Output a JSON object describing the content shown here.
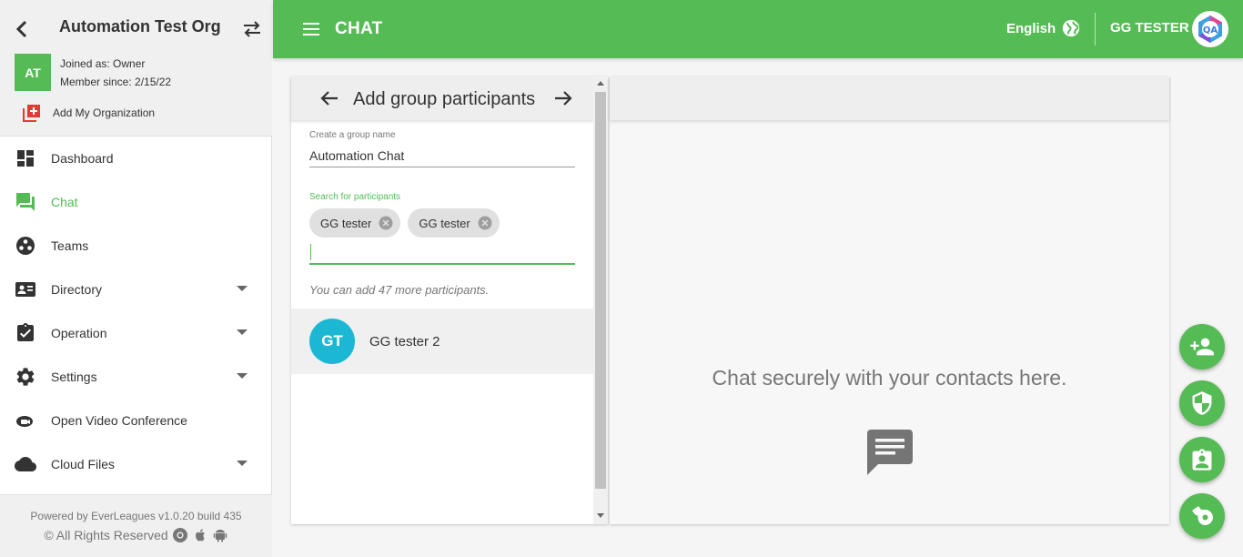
{
  "sidebar": {
    "org_name": "Automation Test Org",
    "org_initials": "AT",
    "joined_as": "Joined as: Owner",
    "member_since": "Member since: 2/15/22",
    "add_org": "Add My Organization",
    "nav": [
      {
        "label": "Dashboard",
        "icon": "dashboard-icon"
      },
      {
        "label": "Chat",
        "icon": "chat-icon",
        "active": true
      },
      {
        "label": "Teams",
        "icon": "teams-icon"
      },
      {
        "label": "Directory",
        "icon": "directory-icon",
        "has_submenu": true
      },
      {
        "label": "Operation",
        "icon": "clipboard-check-icon",
        "has_submenu": true
      },
      {
        "label": "Settings",
        "icon": "gear-icon",
        "has_submenu": true
      },
      {
        "label": "Open Video Conference",
        "icon": "video-icon"
      },
      {
        "label": "Cloud Files",
        "icon": "cloud-icon",
        "has_submenu": true
      }
    ],
    "footer": {
      "powered_by": "Powered by EverLeagues v1.0.20 build 435",
      "rights": "© All Rights Reserved"
    }
  },
  "topbar": {
    "title": "CHAT",
    "language": "English",
    "user_name": "GG TESTER",
    "avatar_text": "QA"
  },
  "group_panel": {
    "title": "Add group participants",
    "group_name_label": "Create a group name",
    "group_name_value": "Automation Chat",
    "search_label": "Search for participants",
    "chips": [
      "GG tester",
      "GG tester"
    ],
    "hint": "You can add 47 more participants.",
    "contacts": [
      {
        "initials": "GT",
        "name": "GG tester 2"
      }
    ]
  },
  "chat_panel": {
    "empty_message": "Chat securely with your contacts here."
  },
  "colors": {
    "brand_green": "#55bb55",
    "contact_avatar": "#1cb8d3"
  }
}
